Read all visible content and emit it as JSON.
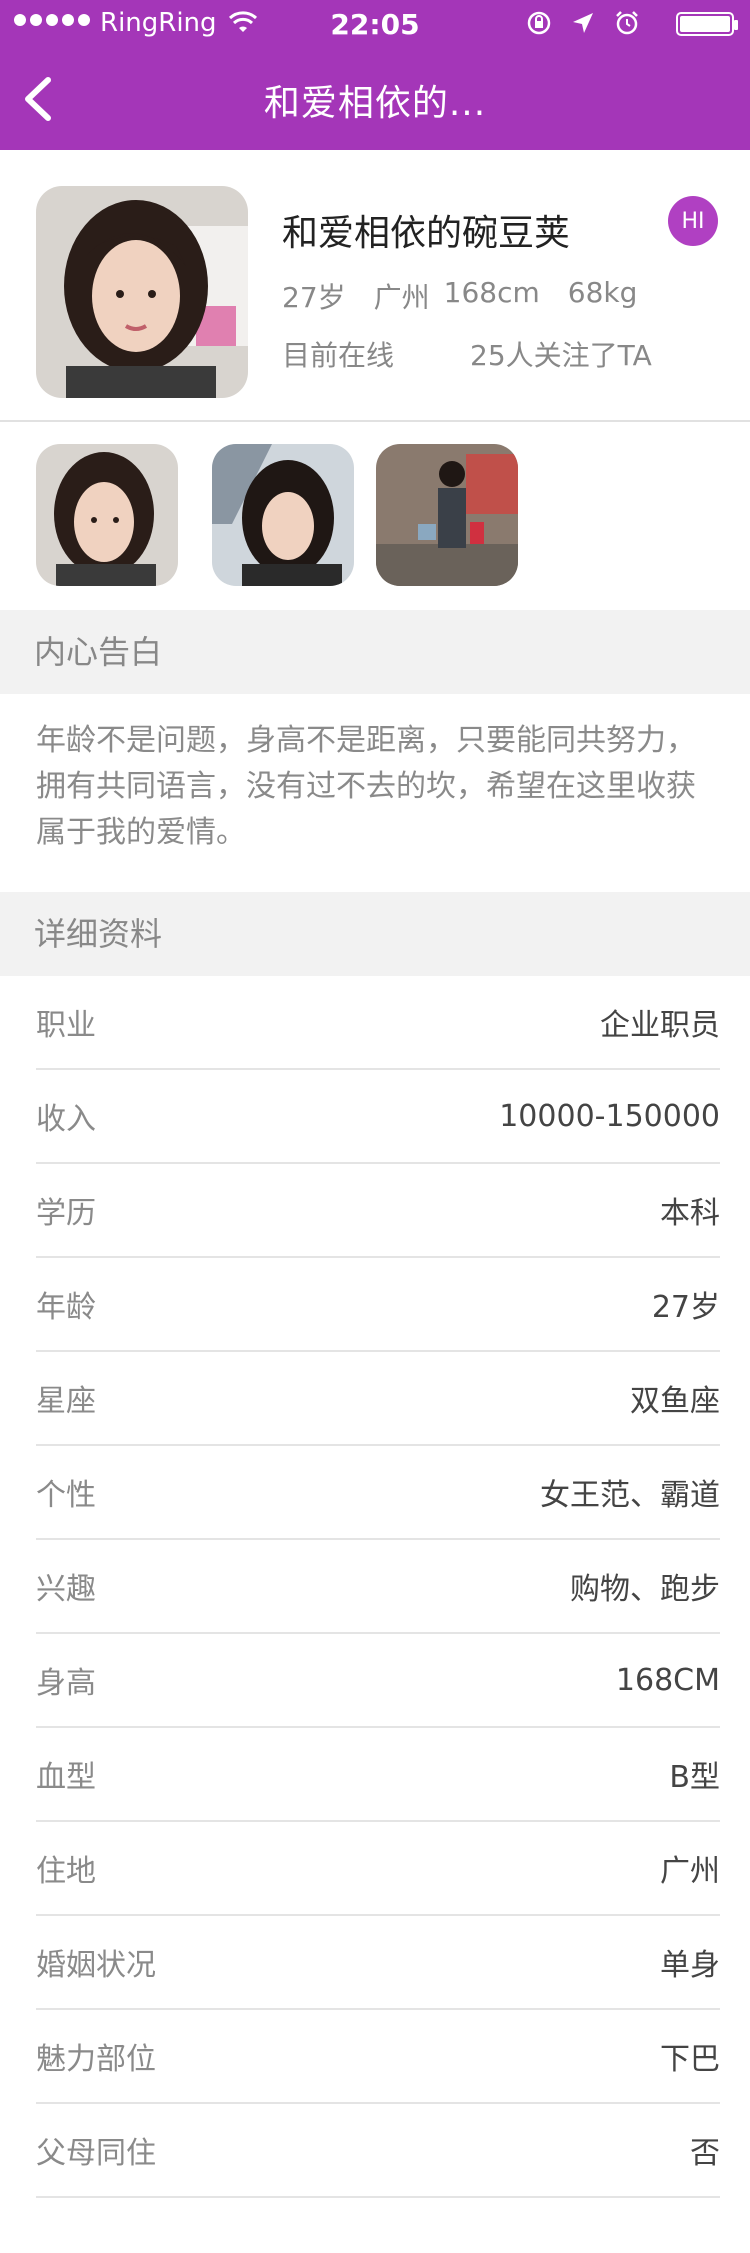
{
  "status_bar": {
    "carrier": "RingRing",
    "time": "22:05"
  },
  "nav": {
    "title": "和爱相依的..."
  },
  "profile": {
    "name": "和爱相依的碗豆荚",
    "hi_label": "HI",
    "age": "27岁",
    "city": "广州",
    "height": "168cm",
    "weight": "68kg",
    "online_status": "目前在线",
    "followers": "25人关注了TA"
  },
  "sections": {
    "confession_title": "内心告白",
    "details_title": "详细资料"
  },
  "confession": {
    "text": "年龄不是问题，身高不是距离，只要能同共努力，拥有共同语言，没有过不去的坎，希望在这里收获属于我的爱情。"
  },
  "details": [
    {
      "label": "职业",
      "value": "企业职员"
    },
    {
      "label": "收入",
      "value": "10000-150000"
    },
    {
      "label": "学历",
      "value": "本科"
    },
    {
      "label": "年龄",
      "value": "27岁"
    },
    {
      "label": "星座",
      "value": "双鱼座"
    },
    {
      "label": "个性",
      "value": "女王范、霸道"
    },
    {
      "label": "兴趣",
      "value": "购物、跑步"
    },
    {
      "label": "身高",
      "value": "168CM"
    },
    {
      "label": "血型",
      "value": "B型"
    },
    {
      "label": "住地",
      "value": "广州"
    },
    {
      "label": "婚姻状况",
      "value": "单身"
    },
    {
      "label": "魅力部位",
      "value": "下巴"
    },
    {
      "label": "父母同住",
      "value": "否"
    }
  ],
  "colors": {
    "brand": "#a436b8",
    "hi_button": "#b040c2"
  }
}
